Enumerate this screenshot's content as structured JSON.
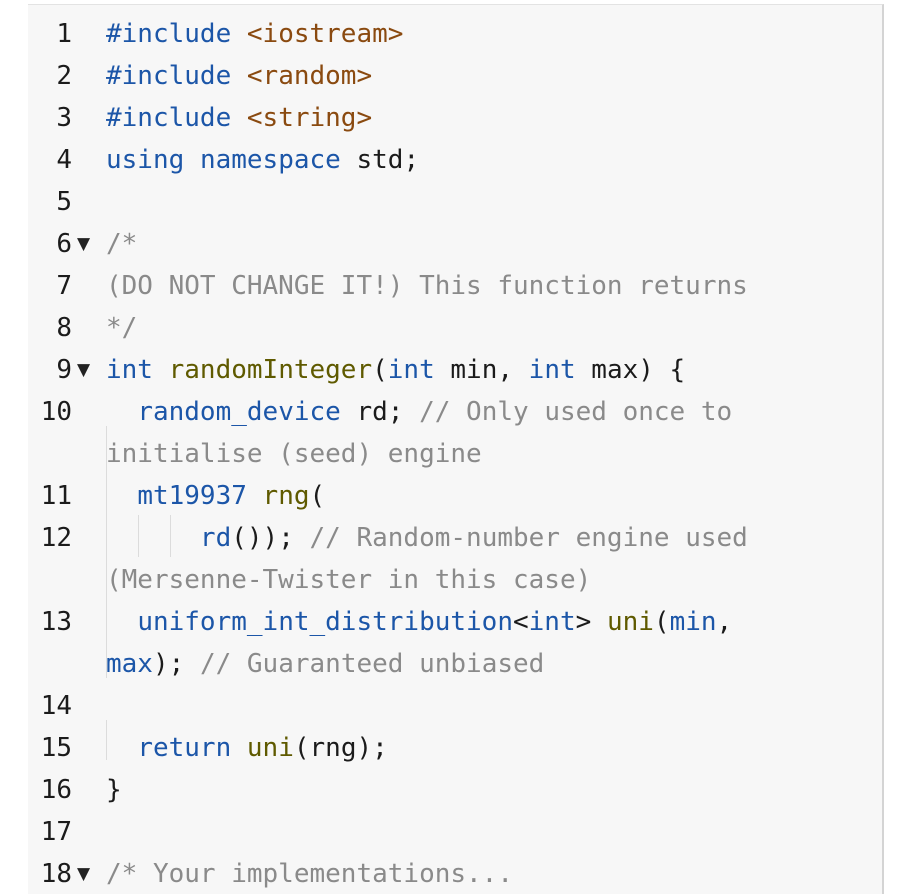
{
  "editor": {
    "lines": [
      {
        "n": "1",
        "parts": [
          {
            "t": "#include",
            "c": "pp"
          },
          {
            "t": " ",
            "c": "vr"
          },
          {
            "t": "<iostream>",
            "c": "str"
          }
        ]
      },
      {
        "n": "2",
        "parts": [
          {
            "t": "#include",
            "c": "pp"
          },
          {
            "t": " ",
            "c": "vr"
          },
          {
            "t": "<random>",
            "c": "str"
          }
        ]
      },
      {
        "n": "3",
        "parts": [
          {
            "t": "#include",
            "c": "pp"
          },
          {
            "t": " ",
            "c": "vr"
          },
          {
            "t": "<string>",
            "c": "str"
          }
        ]
      },
      {
        "n": "4",
        "parts": [
          {
            "t": "using",
            "c": "kw"
          },
          {
            "t": " ",
            "c": "vr"
          },
          {
            "t": "namespace",
            "c": "kw"
          },
          {
            "t": " std;",
            "c": "vr"
          }
        ]
      },
      {
        "n": "5",
        "parts": []
      },
      {
        "n": "6",
        "fold": true,
        "parts": [
          {
            "t": "/*",
            "c": "cm"
          }
        ]
      },
      {
        "n": "7",
        "parts": [
          {
            "t": "(DO NOT CHANGE IT!) This function returns",
            "c": "cm"
          }
        ]
      },
      {
        "n": "8",
        "parts": [
          {
            "t": "*/",
            "c": "cm"
          }
        ]
      },
      {
        "n": "9",
        "fold": true,
        "parts": [
          {
            "t": "int",
            "c": "kw"
          },
          {
            "t": " ",
            "c": "vr"
          },
          {
            "t": "randomInteger",
            "c": "fn"
          },
          {
            "t": "(",
            "c": "vr"
          },
          {
            "t": "int",
            "c": "kw"
          },
          {
            "t": " min, ",
            "c": "vr"
          },
          {
            "t": "int",
            "c": "kw"
          },
          {
            "t": " max) {",
            "c": "vr"
          }
        ]
      },
      {
        "n": "10",
        "parts": [
          {
            "t": "  ",
            "c": "vr"
          },
          {
            "t": "random_device",
            "c": "ty"
          },
          {
            "t": " rd; ",
            "c": "vr"
          },
          {
            "t": "// Only used once to",
            "c": "cm"
          }
        ]
      },
      {
        "n": "",
        "parts": [
          {
            "t": "initialise (seed) engine",
            "c": "cm"
          }
        ]
      },
      {
        "n": "11",
        "parts": [
          {
            "t": "  ",
            "c": "vr"
          },
          {
            "t": "mt19937",
            "c": "ty"
          },
          {
            "t": " ",
            "c": "vr"
          },
          {
            "t": "rng",
            "c": "fn"
          },
          {
            "t": "(",
            "c": "vr"
          }
        ]
      },
      {
        "n": "12",
        "parts": [
          {
            "t": "      ",
            "c": "vr"
          },
          {
            "t": "rd",
            "c": "ty"
          },
          {
            "t": "()); ",
            "c": "vr"
          },
          {
            "t": "// Random-number engine used",
            "c": "cm"
          }
        ]
      },
      {
        "n": "",
        "parts": [
          {
            "t": "(Mersenne-Twister in this case)",
            "c": "cm"
          }
        ]
      },
      {
        "n": "13",
        "parts": [
          {
            "t": "  ",
            "c": "vr"
          },
          {
            "t": "uniform_int_distribution",
            "c": "ty"
          },
          {
            "t": "<",
            "c": "vr"
          },
          {
            "t": "int",
            "c": "kw"
          },
          {
            "t": "> ",
            "c": "vr"
          },
          {
            "t": "uni",
            "c": "fn"
          },
          {
            "t": "(",
            "c": "vr"
          },
          {
            "t": "min",
            "c": "ty"
          },
          {
            "t": ",",
            "c": "vr"
          }
        ]
      },
      {
        "n": "",
        "parts": [
          {
            "t": "max",
            "c": "ty"
          },
          {
            "t": "); ",
            "c": "vr"
          },
          {
            "t": "// Guaranteed unbiased",
            "c": "cm"
          }
        ]
      },
      {
        "n": "14",
        "parts": []
      },
      {
        "n": "15",
        "parts": [
          {
            "t": "  ",
            "c": "vr"
          },
          {
            "t": "return",
            "c": "kw"
          },
          {
            "t": " ",
            "c": "vr"
          },
          {
            "t": "uni",
            "c": "fn"
          },
          {
            "t": "(rng);",
            "c": "vr"
          }
        ]
      },
      {
        "n": "16",
        "parts": [
          {
            "t": "}",
            "c": "vr"
          }
        ]
      },
      {
        "n": "17",
        "parts": []
      },
      {
        "n": "18",
        "fold": true,
        "parts": [
          {
            "t": "/* Your implementations...",
            "c": "cm"
          }
        ]
      }
    ],
    "fold_glyph": "▼"
  }
}
